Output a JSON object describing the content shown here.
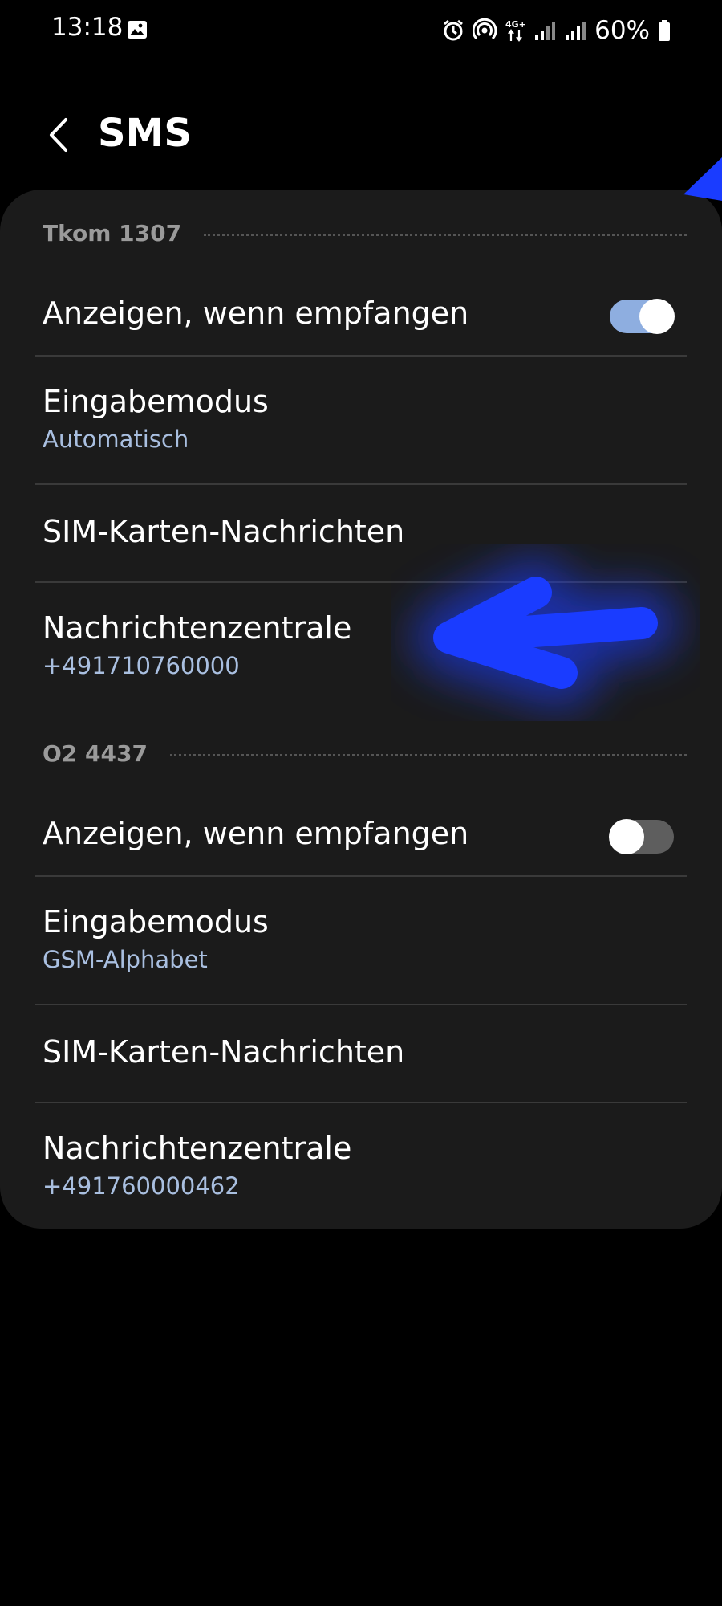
{
  "status_bar": {
    "time": "13:18",
    "battery": "60%",
    "network": "4G+"
  },
  "header": {
    "title": "SMS"
  },
  "sections": [
    {
      "label": "Tkom 1307",
      "show_when_received": {
        "label": "Anzeigen, wenn empfangen",
        "enabled": true
      },
      "input_mode": {
        "label": "Eingabemodus",
        "value": "Automatisch"
      },
      "sim_messages": {
        "label": "SIM-Karten-Nachrichten"
      },
      "message_center": {
        "label": "Nachrichtenzentrale",
        "value": "+491710760000"
      }
    },
    {
      "label": "O2 4437",
      "show_when_received": {
        "label": "Anzeigen, wenn empfangen",
        "enabled": false
      },
      "input_mode": {
        "label": "Eingabemodus",
        "value": "GSM-Alphabet"
      },
      "sim_messages": {
        "label": "SIM-Karten-Nachrichten"
      },
      "message_center": {
        "label": "Nachrichtenzentrale",
        "value": "+491760000462"
      }
    }
  ],
  "colors": {
    "background": "#000000",
    "card": "#1b1b1b",
    "accent_subtext": "#a9bfe0",
    "toggle_on": "#8eaee0",
    "annotation_stroke": "#1a3cff"
  }
}
